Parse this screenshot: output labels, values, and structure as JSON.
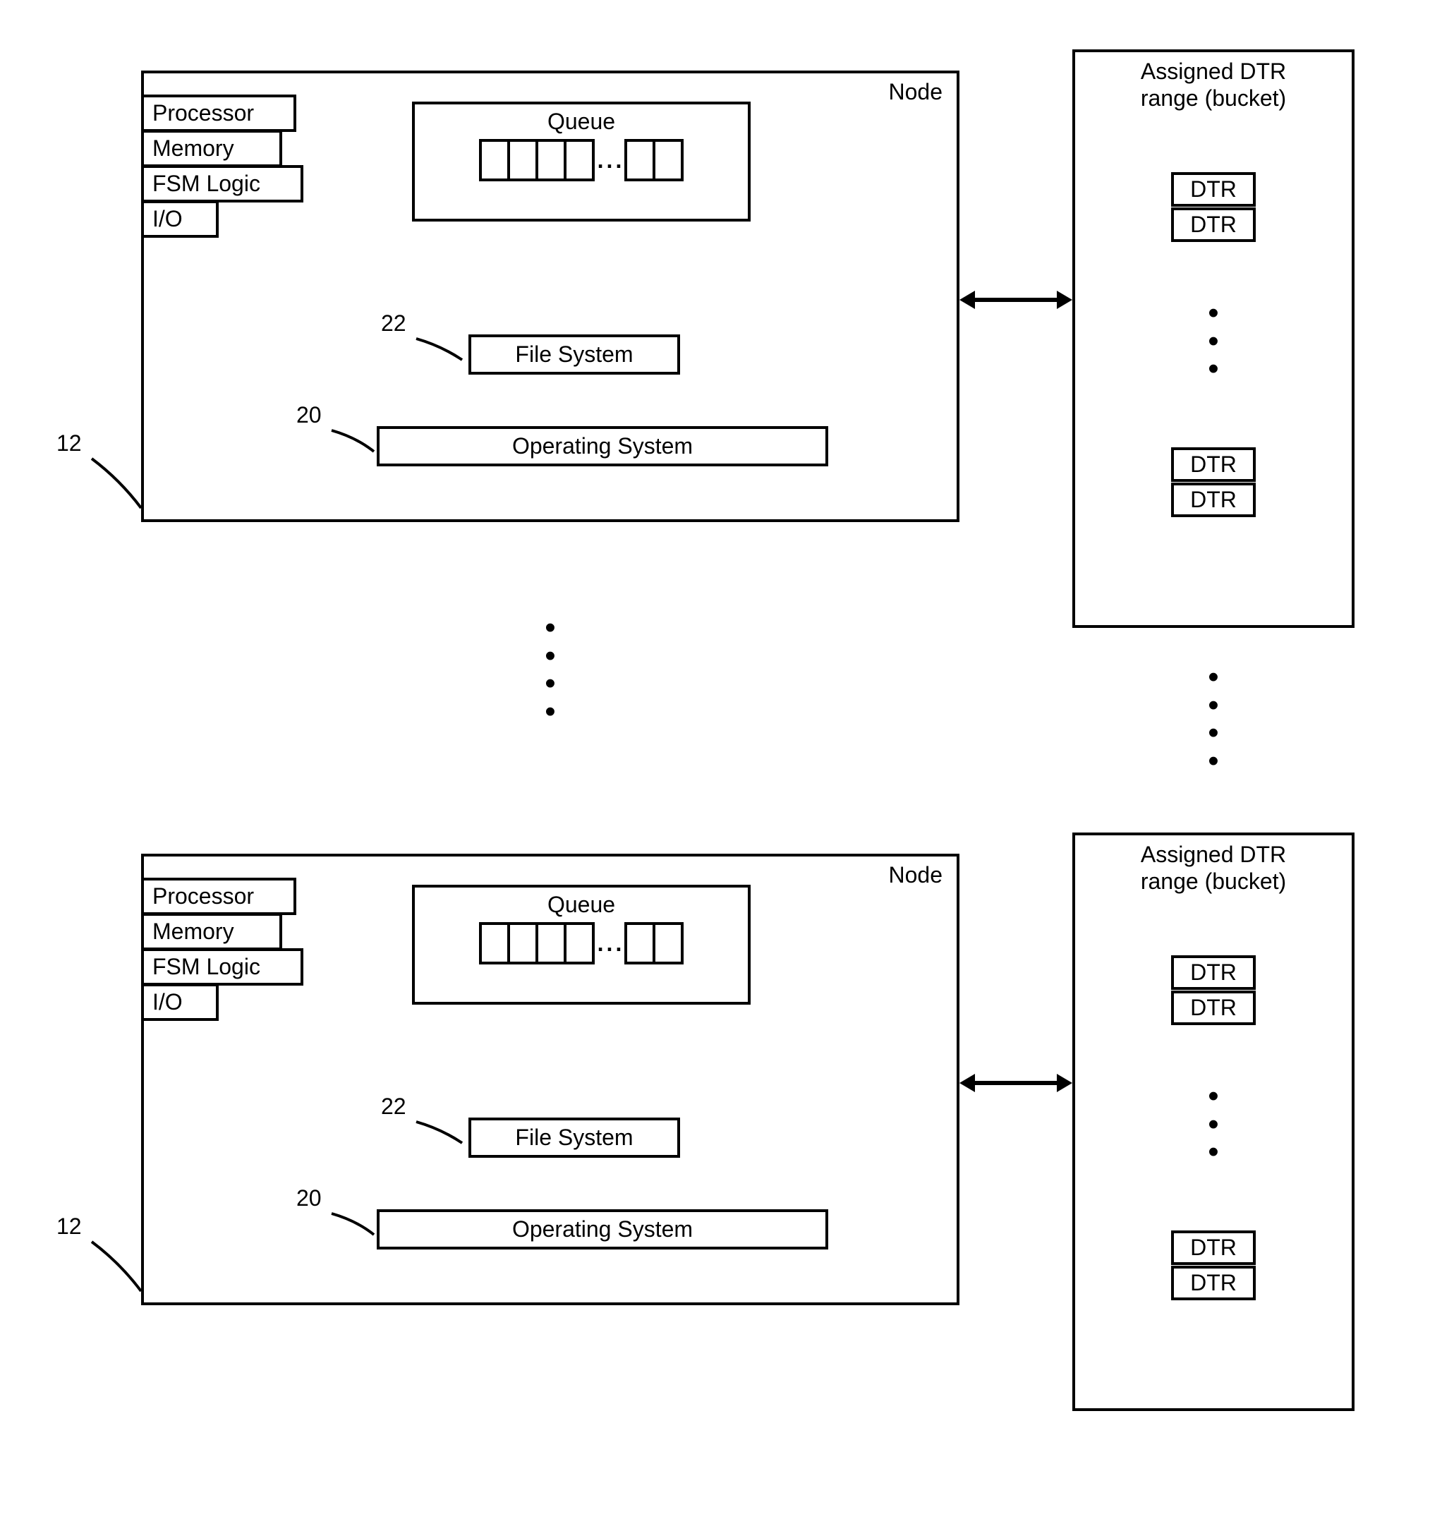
{
  "diagram": {
    "refs": {
      "node_ref": "12",
      "os_ref": "20",
      "fs_ref": "22"
    },
    "node": {
      "title": "Node",
      "components": {
        "processor": "Processor",
        "memory": "Memory",
        "fsm_logic": "FSM Logic",
        "io": "I/O"
      },
      "queue_label": "Queue",
      "queue_ellipsis": "...",
      "file_system": "File System",
      "operating_system": "Operating System"
    },
    "bucket": {
      "title_line1": "Assigned DTR",
      "title_line2": "range (bucket)",
      "dtr_label": "DTR"
    }
  }
}
